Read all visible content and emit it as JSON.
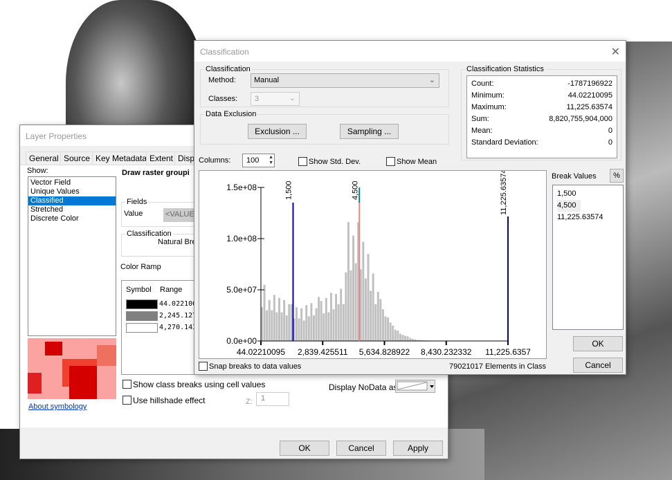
{
  "layer_properties": {
    "title": "Layer Properties",
    "tabs": [
      "General",
      "Source",
      "Key Metadata",
      "Extent",
      "Displ"
    ],
    "show_label": "Show:",
    "show_items": [
      "Vector Field",
      "Unique Values",
      "Classified",
      "Stretched",
      "Discrete Color"
    ],
    "selected_show": "Classified",
    "draw_heading": "Draw raster groupi",
    "fields_label": "Fields",
    "value_label": "Value",
    "value_field": "<VALUE>",
    "classification_label": "Classification",
    "classification_method": "Natural Bre",
    "color_ramp_label": "Color Ramp",
    "symbol_header": "Symbol",
    "range_header": "Range",
    "classes": [
      {
        "color": "#000000",
        "range": "44.022100"
      },
      {
        "color": "#808080",
        "range": "2,245.127"
      },
      {
        "color": "#ffffff",
        "range": "4,270.143"
      }
    ],
    "about_link": "About symbology",
    "show_class_breaks": "Show class breaks using cell values",
    "use_hillshade": "Use hillshade effect",
    "z_label": "Z:",
    "z_value": "1",
    "nodata_label": "Display NoData as",
    "ok": "OK",
    "cancel": "Cancel",
    "apply": "Apply"
  },
  "classification": {
    "title": "Classification",
    "group_classification": "Classification",
    "method_label": "Method:",
    "method_value": "Manual",
    "classes_label": "Classes:",
    "classes_value": "3",
    "group_exclusion": "Data Exclusion",
    "exclusion_btn": "Exclusion ...",
    "sampling_btn": "Sampling ...",
    "stats_title": "Classification Statistics",
    "stats": [
      {
        "k": "Count:",
        "v": "-1787196922"
      },
      {
        "k": "Minimum:",
        "v": "44.02210095"
      },
      {
        "k": "Maximum:",
        "v": "11,225.63574"
      },
      {
        "k": "Sum:",
        "v": "8,820,755,904,000"
      },
      {
        "k": "Mean:",
        "v": "0"
      },
      {
        "k": "Standard Deviation:",
        "v": "0"
      }
    ],
    "columns_label": "Columns:",
    "columns_value": "100",
    "show_std": "Show Std. Dev.",
    "show_mean": "Show Mean",
    "break_values_label": "Break Values",
    "percent_btn": "%",
    "break_values": [
      "1,500",
      "4,500",
      "11,225.63574"
    ],
    "snap_label": "Snap breaks to data values",
    "elements_text": "79021017 Elements in Class",
    "ok": "OK",
    "cancel": "Cancel"
  },
  "chart_data": {
    "type": "bar",
    "xlim": [
      44.02210095,
      11225.63574
    ],
    "ylim": [
      0,
      150000000
    ],
    "x_tick_labels": [
      "44.02210095",
      "2,839.425511",
      "5,634.828922",
      "8,430.232332",
      "11,225.6357"
    ],
    "x_ticks": [
      44.02210095,
      2839.425511,
      5634.828922,
      8430.232332,
      11225.6357
    ],
    "y_tick_labels": [
      "0.0e+00",
      "5.0e+07",
      "1.0e+08",
      "1.5e+08"
    ],
    "y_ticks": [
      0,
      50000000,
      100000000,
      150000000
    ],
    "bar_color": "#c0c0c0",
    "breaks": [
      {
        "value": 1500,
        "label": "1,500",
        "color": "#0000c0"
      },
      {
        "value": 4500,
        "label": "4,500",
        "color": "#f08080",
        "selected_color": "#008080"
      },
      {
        "value": 11225.63574,
        "label": "11,225.63574",
        "color": "#0000c0"
      }
    ],
    "values_millions": [
      33,
      55,
      30,
      40,
      30,
      45,
      28,
      42,
      28,
      40,
      25,
      36,
      36,
      22,
      33,
      22,
      32,
      20,
      35,
      24,
      37,
      25,
      32,
      43,
      39,
      27,
      42,
      28,
      47,
      31,
      46,
      36,
      51,
      36,
      67,
      116,
      69,
      103,
      76,
      116,
      70,
      97,
      61,
      85,
      49,
      66,
      36,
      48,
      41,
      31,
      24,
      23,
      18,
      15,
      11,
      10,
      7,
      6,
      5,
      4.5,
      3,
      2,
      1.5,
      1,
      1,
      0.8,
      0.6,
      0.5,
      0.4,
      0.3,
      0.2,
      0.2,
      0.1,
      0,
      0,
      0,
      0,
      0,
      0,
      0,
      0,
      0,
      0,
      0,
      0,
      0,
      0,
      0,
      0,
      0,
      0,
      0,
      0,
      0,
      0,
      0,
      0,
      0,
      0,
      0
    ]
  }
}
